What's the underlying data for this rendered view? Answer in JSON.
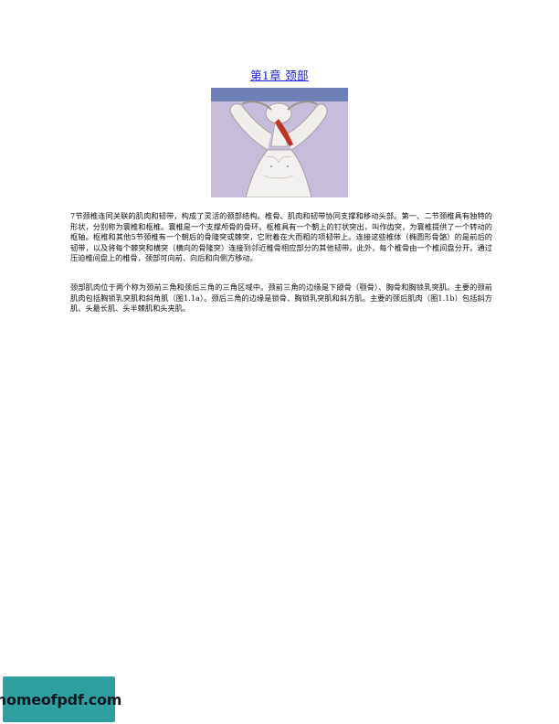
{
  "chapter": {
    "title": "第1章 颈部"
  },
  "figure": {
    "description_icon": "neck-stretch-anatomy-illustration",
    "colors": {
      "band_top": "#6f7fb8",
      "background": "#c7bddb",
      "muscle": "#c0392b",
      "skin": "#f2f0ee"
    }
  },
  "paragraphs": [
    "7节颈椎连同关联的肌肉和韧带，构成了灵活的颈部结构。椎骨、肌肉和韧带协同支撑和移动头部。第一、二节颈椎具有独特的形状，分别称为寰椎和枢椎。寰椎是一个支撑颅骨的骨环。枢椎具有一个朝上的钉状突出，叫作齿突，为寰椎提供了一个转动的枢轴。枢椎和其他5节颈椎有一个朝后的骨隆突或棘突，它附着在大而粗的项韧带上。连接这些椎体（椭圆形骨骼）的是前后的韧带，以及将每个棘突和横突（横向的骨隆突）连接到邻近椎骨相应部分的其他韧带。此外，每个椎骨由一个椎间盘分开。通过压迫椎间盘上的椎骨，颈部可向前、向后和向侧方移动。",
    "颈部肌肉位于两个称为颈前三角和颈后三角的三角区域中。颈前三角的边缘是下颌骨（颚骨）、胸骨和胸锁乳突肌。主要的颈前肌肉包括胸锁乳突肌和斜角肌（图1.1a）。颈后三角的边缘是锁骨、胸锁乳突肌和斜方肌。主要的颈后肌肉（图1.1b）包括斜方肌、头最长肌、头半棘肌和头夹肌。"
  ],
  "watermark": {
    "text": "homeofpdf.com",
    "color": "#2f9fa0"
  }
}
